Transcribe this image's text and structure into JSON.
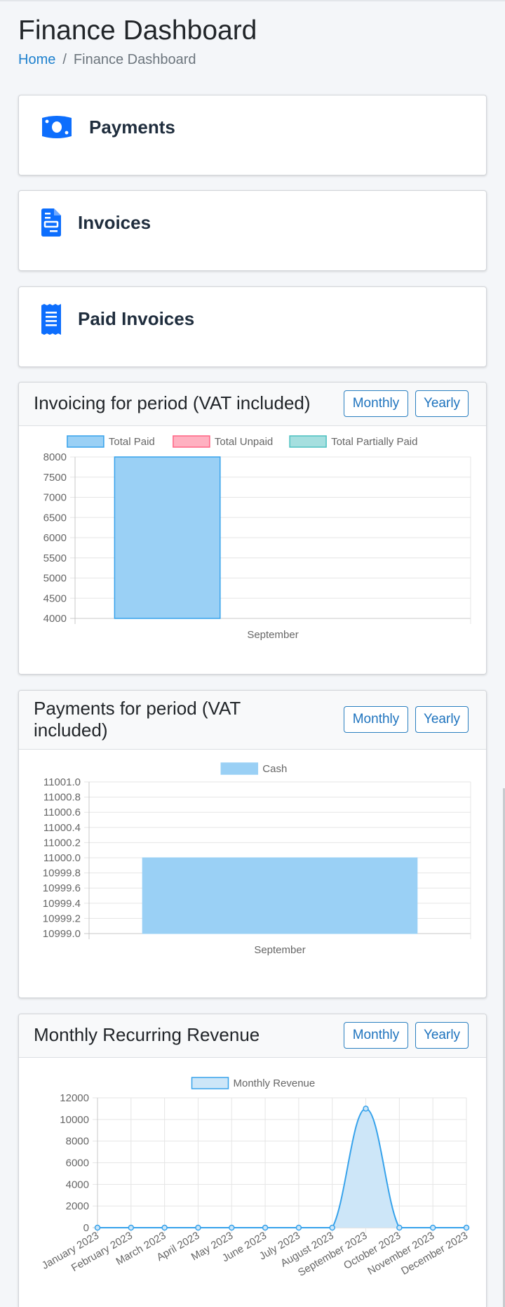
{
  "page": {
    "title": "Finance Dashboard",
    "breadcrumb": {
      "home": "Home",
      "separator": "/",
      "current": "Finance Dashboard"
    }
  },
  "stats": [
    {
      "label": "Payments",
      "icon": "money-bill-icon"
    },
    {
      "label": "Invoices",
      "icon": "file-invoice-icon"
    },
    {
      "label": "Paid Invoices",
      "icon": "receipt-icon"
    }
  ],
  "charts": {
    "invoicing": {
      "title": "Invoicing for period (VAT included)",
      "monthly_label": "Monthly",
      "yearly_label": "Yearly"
    },
    "payments": {
      "title_line1": "Payments for period (VAT",
      "title_line2": "included)",
      "monthly_label": "Monthly",
      "yearly_label": "Yearly"
    },
    "mrr": {
      "title": "Monthly Recurring Revenue",
      "monthly_label": "Monthly",
      "yearly_label": "Yearly"
    }
  },
  "colors": {
    "accent": "#1e73be",
    "paid_fill": "#9ad0f5",
    "paid_stroke": "#36a2eb",
    "unpaid_fill": "#ffb1c1",
    "unpaid_stroke": "#ff6384",
    "partial_fill": "#a5dfdf",
    "partial_stroke": "#4bc0c0",
    "icon_blue": "#0d6efd"
  },
  "chart_data": [
    {
      "type": "bar",
      "categories": [
        "September"
      ],
      "series": [
        {
          "name": "Total Paid",
          "values": [
            8000
          ]
        },
        {
          "name": "Total Unpaid",
          "values": [
            0
          ]
        },
        {
          "name": "Total Partially Paid",
          "values": [
            0
          ]
        }
      ],
      "ylim": [
        4000,
        8000
      ],
      "yticks": [
        "8000",
        "7500",
        "7000",
        "6500",
        "6000",
        "5500",
        "5000",
        "4500",
        "4000"
      ],
      "legend": "top",
      "grid": true
    },
    {
      "type": "bar",
      "categories": [
        "September"
      ],
      "series": [
        {
          "name": "Cash",
          "values": [
            11000.0
          ]
        }
      ],
      "ylim": [
        10999.0,
        11001.0
      ],
      "yticks": [
        "11001.0",
        "11000.8",
        "11000.6",
        "11000.4",
        "11000.2",
        "11000.0",
        "10999.8",
        "10999.6",
        "10999.4",
        "10999.2",
        "10999.0"
      ],
      "legend": "top",
      "grid": true
    },
    {
      "type": "area",
      "categories": [
        "January 2023",
        "February 2023",
        "March 2023",
        "April 2023",
        "May 2023",
        "June 2023",
        "July 2023",
        "August 2023",
        "September 2023",
        "October 2023",
        "November 2023",
        "December 2023"
      ],
      "series": [
        {
          "name": "Monthly Revenue",
          "values": [
            0,
            0,
            0,
            0,
            0,
            0,
            0,
            0,
            11000,
            0,
            0,
            0
          ]
        }
      ],
      "ylim": [
        0,
        12000
      ],
      "yticks": [
        "12000",
        "10000",
        "8000",
        "6000",
        "4000",
        "2000",
        "0"
      ],
      "legend": "top",
      "grid": true
    }
  ]
}
